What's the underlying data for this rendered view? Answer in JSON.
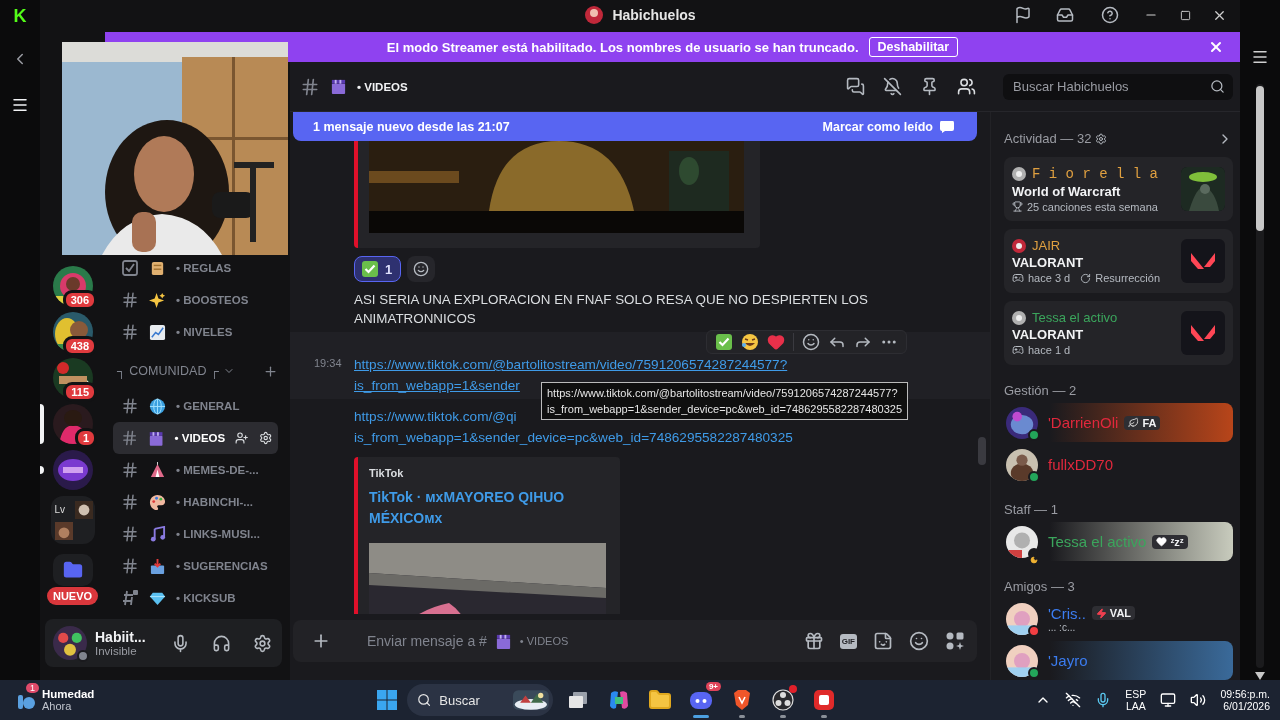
{
  "left_strip": {
    "logo": "K"
  },
  "title_bar": {
    "title": "Habichuelos"
  },
  "streamer_banner": {
    "message": "El modo Streamer está habilitado. Los nombres de usuario se han truncado.",
    "button": "Deshabilitar"
  },
  "servers": [
    {
      "kind": "server",
      "badge": "306",
      "selected": false,
      "unread": false
    },
    {
      "kind": "server",
      "badge": "438",
      "selected": false,
      "unread": false
    },
    {
      "kind": "server",
      "badge": "115",
      "selected": false,
      "unread": false
    },
    {
      "kind": "server",
      "badge": "1",
      "selected": true,
      "unread": false
    },
    {
      "kind": "server",
      "selected": false,
      "unread": true
    },
    {
      "kind": "group",
      "label": "Lv",
      "selected": false,
      "unread": false
    },
    {
      "kind": "folder",
      "badge": "NUEVO",
      "selected": false,
      "unread": false
    }
  ],
  "channels": [
    {
      "kind": "rules",
      "name": "• REGLAS",
      "selected": false
    },
    {
      "kind": "text",
      "name": "• BOOSTEOS",
      "selected": false
    },
    {
      "kind": "text",
      "name": "• NIVELES",
      "selected": false
    },
    {
      "kind": "category",
      "name": "┐ COMUNIDAD ┌",
      "expanded": true
    },
    {
      "kind": "text",
      "name": "• GENERAL",
      "selected": false
    },
    {
      "kind": "text",
      "name": "• VIDEOS",
      "selected": true
    },
    {
      "kind": "text",
      "name": "• MEMES-DE-...",
      "selected": false
    },
    {
      "kind": "text",
      "name": "• HABINCHI-...",
      "selected": false
    },
    {
      "kind": "text",
      "name": "• LINKS-MUSI...",
      "selected": false
    },
    {
      "kind": "text",
      "name": "• SUGERENCIAS",
      "selected": false
    },
    {
      "kind": "locked",
      "name": "• KICKSUB",
      "selected": false
    }
  ],
  "user_panel": {
    "name": "Habiit...",
    "status": "Invisible"
  },
  "channel_header": {
    "name": "• VIDEOS"
  },
  "search": {
    "placeholder": "Buscar Habichuelos"
  },
  "new_messages_bar": {
    "text": "1 mensaje nuevo desde las 21:07",
    "action": "Marcar como leído"
  },
  "reactions": [
    {
      "count": "1",
      "selected": true
    }
  ],
  "message_text": "ASI SERIA UNA EXPLORACION EN FNAF SOLO RESA QUE NO DESPIERTEN LOS ANIMATRONNICOS",
  "link_messages": [
    {
      "time": "19:34",
      "hovered": true,
      "lines": [
        "https://www.tiktok.com/@bartolitostream/video/7591206574287244577?",
        "is_from_webapp=1&sender"
      ]
    },
    {
      "hovered": false,
      "lines": [
        "https://www.tiktok.com/@qi",
        "is_from_webapp=1&sender_device=pc&web_id=7486295582287480325"
      ]
    }
  ],
  "link_tooltip": {
    "lines": [
      "https://www.tiktok.com/@bartolitostream/video/7591206574287244577?",
      "is_from_webapp=1&sender_device=pc&web_id=7486295582287480325"
    ]
  },
  "embed": {
    "provider": "TikTok",
    "title": "TikTok · мxMAYOREO QIHUO MÉXICOмx"
  },
  "composer": {
    "placeholder": "Enviar mensaje a #",
    "channel": "• VIDEOS",
    "gif": "GIF"
  },
  "activity": {
    "title": "Actividad — 32",
    "cards": [
      {
        "kind": "picture",
        "user": "F i o r e l l a",
        "color": "#e0a040",
        "game": "World of Warcraft",
        "details": [
          {
            "kind": "trophy",
            "text": "25 canciones esta semana"
          }
        ]
      },
      {
        "kind": "logo",
        "user": "JAIR",
        "color": "#e0a040",
        "game": "VALORANT",
        "details": [
          {
            "kind": "gamepad",
            "text": "hace 3 d"
          },
          {
            "kind": "replay",
            "text": "Resurrección"
          }
        ]
      },
      {
        "kind": "logo",
        "user": "Tessa el activo",
        "color": "#3ba55c",
        "game": "VALORANT",
        "details": [
          {
            "kind": "gamepad",
            "text": "hace 1 d"
          }
        ]
      }
    ]
  },
  "member_groups": [
    {
      "title": "Gestión — 2",
      "members": [
        {
          "kind": "online",
          "name": "'DarrienOli",
          "color": "#e0283c",
          "tag": "FA"
        },
        {
          "kind": "online",
          "name": "fullxDD70",
          "color": "#e0283c"
        }
      ]
    },
    {
      "title": "Staff — 1",
      "members": [
        {
          "kind": "idle",
          "name": "Tessa el activo",
          "color": "#3ba55c",
          "tag": "ᶻzᶻ"
        }
      ]
    },
    {
      "title": "Amigos — 3",
      "members": [
        {
          "kind": "dnd",
          "name": "'Cris..",
          "color": "#3b7cf0",
          "tag": "VAL",
          "status_text": "... :c..."
        },
        {
          "kind": "online",
          "name": "'Jayro",
          "color": "#3b7cf0"
        }
      ]
    }
  ],
  "taskbar": {
    "weather": {
      "badge": "1",
      "title": "Humedad",
      "subtitle": "Ahora"
    },
    "search": {
      "placeholder": "Buscar"
    },
    "apps": [
      {
        "kind": "task_view",
        "active": false,
        "running": false
      },
      {
        "kind": "copilot",
        "active": false,
        "running": false
      },
      {
        "kind": "explorer",
        "active": false,
        "running": false
      },
      {
        "kind": "discord",
        "active": true,
        "running": true,
        "badge": "9+"
      },
      {
        "kind": "brave",
        "active": false,
        "running": true
      },
      {
        "kind": "obs",
        "active": false,
        "running": true,
        "alert": true
      },
      {
        "kind": "red_app",
        "active": false,
        "running": true
      }
    ],
    "language": [
      "ESP",
      "LAA"
    ],
    "time": "09:56:p.m.",
    "date": "6/01/2026"
  }
}
